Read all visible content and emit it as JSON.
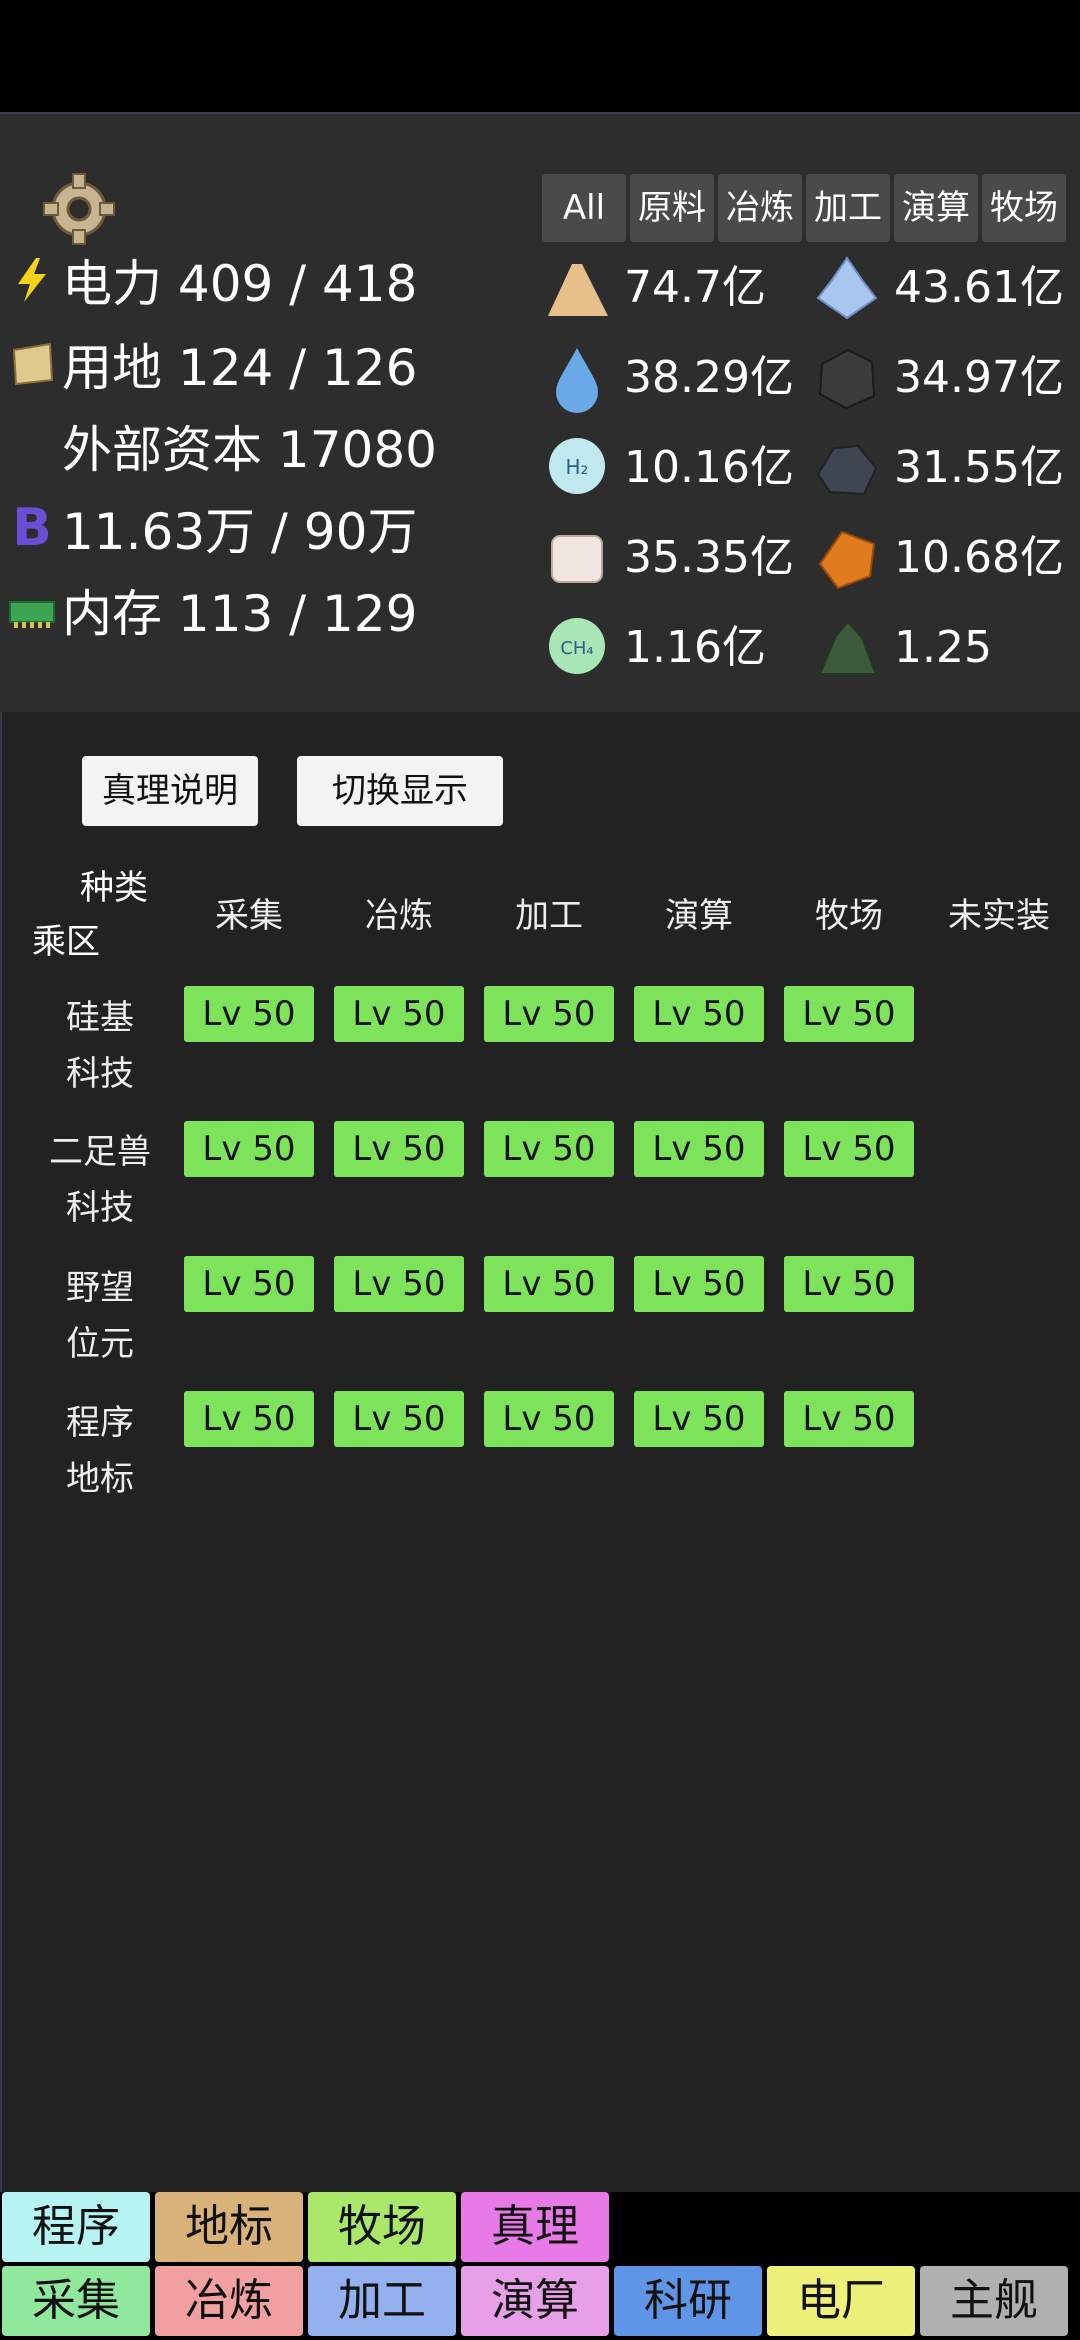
{
  "stats": {
    "power": "电力 409 / 418",
    "land": "用地 124 / 126",
    "external_capital": "外部资本 17080",
    "bits": "11.63万 / 90万",
    "memory": "内存 113 / 129"
  },
  "resource_tabs": [
    "All",
    "原料",
    "冶炼",
    "加工",
    "演算",
    "牧场"
  ],
  "resources": [
    {
      "icon": "sand-icon",
      "value": "74.7亿"
    },
    {
      "icon": "crystal-icon",
      "value": "43.61亿"
    },
    {
      "icon": "water-icon",
      "value": "38.29亿"
    },
    {
      "icon": "coal-icon",
      "value": "34.97亿"
    },
    {
      "icon": "hydrogen-icon",
      "value": "10.16亿"
    },
    {
      "icon": "ore-icon",
      "value": "31.55亿"
    },
    {
      "icon": "salt-icon",
      "value": "35.35亿"
    },
    {
      "icon": "amber-icon",
      "value": "10.68亿"
    },
    {
      "icon": "methane-icon",
      "value": "1.16亿"
    },
    {
      "icon": "green-ore-icon",
      "value": "1.25"
    }
  ],
  "section_title": "真理",
  "buttons": {
    "explain": "真理说明",
    "toggle": "切换显示"
  },
  "table": {
    "corner_top": "种类",
    "corner_bottom": "乘区",
    "columns": [
      "采集",
      "冶炼",
      "加工",
      "演算",
      "牧场",
      "未实装"
    ],
    "rows": [
      {
        "line1": "硅基",
        "line2": "科技",
        "levels": [
          "Lv 50",
          "Lv 50",
          "Lv 50",
          "Lv 50",
          "Lv 50"
        ]
      },
      {
        "line1": "二足兽",
        "line2": "科技",
        "levels": [
          "Lv 50",
          "Lv 50",
          "Lv 50",
          "Lv 50",
          "Lv 50"
        ]
      },
      {
        "line1": "野望",
        "line2": "位元",
        "levels": [
          "Lv 50",
          "Lv 50",
          "Lv 50",
          "Lv 50",
          "Lv 50"
        ]
      },
      {
        "line1": "程序",
        "line2": "地标",
        "levels": [
          "Lv 50",
          "Lv 50",
          "Lv 50",
          "Lv 50",
          "Lv 50"
        ]
      }
    ]
  },
  "bottom_tabs_row1": [
    {
      "label": "程序",
      "color": "#b6f3f3"
    },
    {
      "label": "地标",
      "color": "#d9b27a"
    },
    {
      "label": "牧场",
      "color": "#a9e86b"
    },
    {
      "label": "真理",
      "color": "#e87ae8"
    }
  ],
  "bottom_tabs_row2": [
    {
      "label": "采集",
      "color": "#8fe89b"
    },
    {
      "label": "冶炼",
      "color": "#f0a0a0"
    },
    {
      "label": "加工",
      "color": "#93b0ef"
    },
    {
      "label": "演算",
      "color": "#e79fe8"
    },
    {
      "label": "科研",
      "color": "#5f95e6"
    },
    {
      "label": "电厂",
      "color": "#eef07a"
    },
    {
      "label": "主舰",
      "color": "#b0b0b0"
    }
  ],
  "colors": {
    "level_badge": "#7de35a",
    "panel_bg": "#222222",
    "top_panel_bg": "#2d2d2d"
  }
}
